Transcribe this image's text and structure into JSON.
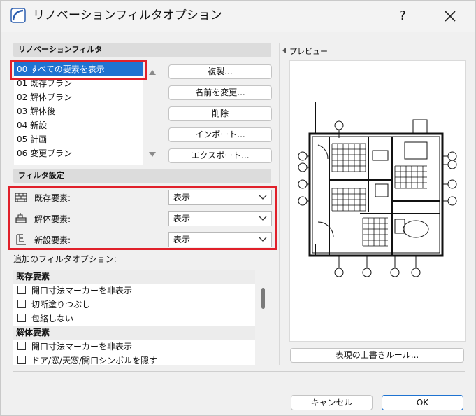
{
  "window": {
    "title": "リノベーションフィルタオプション",
    "help_label": "?"
  },
  "renovation_filter": {
    "header": "リノベーションフィルタ",
    "items": [
      "00 すべての要素を表示",
      "01 既存プラン",
      "02 解体プラン",
      "03 解体後",
      "04 新設",
      "05 計画",
      "06 変更プラン"
    ],
    "selected_index": 0
  },
  "actions": {
    "duplicate": "複製...",
    "rename": "名前を変更...",
    "delete": "削除",
    "import": "インポート...",
    "export": "エクスポート..."
  },
  "filter_settings": {
    "header": "フィルタ設定",
    "rows": [
      {
        "label": "既存要素:",
        "value": "表示",
        "icon": "existing-element-icon"
      },
      {
        "label": "解体要素:",
        "value": "表示",
        "icon": "demolish-element-icon"
      },
      {
        "label": "新設要素:",
        "value": "表示",
        "icon": "new-element-icon"
      }
    ]
  },
  "additional_options": {
    "label": "追加のフィルタオプション:",
    "groups": [
      {
        "name": "既存要素",
        "items": [
          "開口寸法マーカーを非表示",
          "切断塗りつぶし",
          "包絡しない"
        ]
      },
      {
        "name": "解体要素",
        "items": [
          "開口寸法マーカーを非表示",
          "ドア/窓/天窓/開口シンボルを隠す"
        ]
      }
    ]
  },
  "preview": {
    "label": "プレビュー",
    "override_button": "表現の上書きルール..."
  },
  "footer": {
    "cancel": "キャンセル",
    "ok": "OK"
  },
  "colors": {
    "selection": "#1f73d1",
    "highlight_box": "#e0202a",
    "section_header_bg": "#dcdcdc"
  }
}
